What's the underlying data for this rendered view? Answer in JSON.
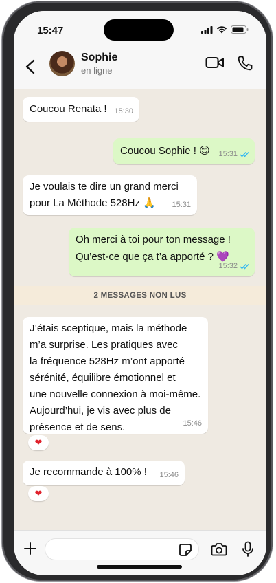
{
  "status_bar": {
    "time": "15:47"
  },
  "header": {
    "contact_name": "Sophie",
    "contact_status": "en ligne"
  },
  "messages": [
    {
      "direction": "in",
      "text": "Coucou Renata !",
      "time": "15:30"
    },
    {
      "direction": "out",
      "text": "Coucou Sophie ! 😊",
      "time": "15:31",
      "read": true
    },
    {
      "direction": "in",
      "text": "Je voulais te dire un grand merci\npour La Méthode 528Hz 🙏",
      "time": "15:31"
    },
    {
      "direction": "out",
      "text": "Oh merci à toi pour ton message !\nQu’est-ce que ça t’a apporté ? 💜",
      "time": "15:32",
      "read": true
    },
    {
      "direction": "in",
      "text": "J’étais sceptique, mais la méthode\nm’a surprise. Les pratiques avec\nla fréquence 528Hz m’ont apporté\nsérénité, équilibre émotionnel et\nune nouvelle connexion à moi-même.\nAujourd’hui, je vis avec plus de\nprésence et de sens.",
      "time": "15:46",
      "reaction": "❤"
    },
    {
      "direction": "in",
      "text": "Je recommande à 100% !",
      "time": "15:46",
      "reaction": "❤"
    }
  ],
  "unread_banner": "2 MESSAGES NON LUS",
  "colors": {
    "incoming_bubble": "#ffffff",
    "outgoing_bubble": "#dcf8c6",
    "chat_background": "#efeae2",
    "read_ticks": "#34b7f1",
    "unread_banner": "#f5ebda"
  },
  "icons": [
    "back-arrow-icon",
    "video-call-icon",
    "phone-call-icon",
    "plus-icon",
    "sticker-icon",
    "camera-icon",
    "microphone-icon",
    "double-check-icon"
  ]
}
